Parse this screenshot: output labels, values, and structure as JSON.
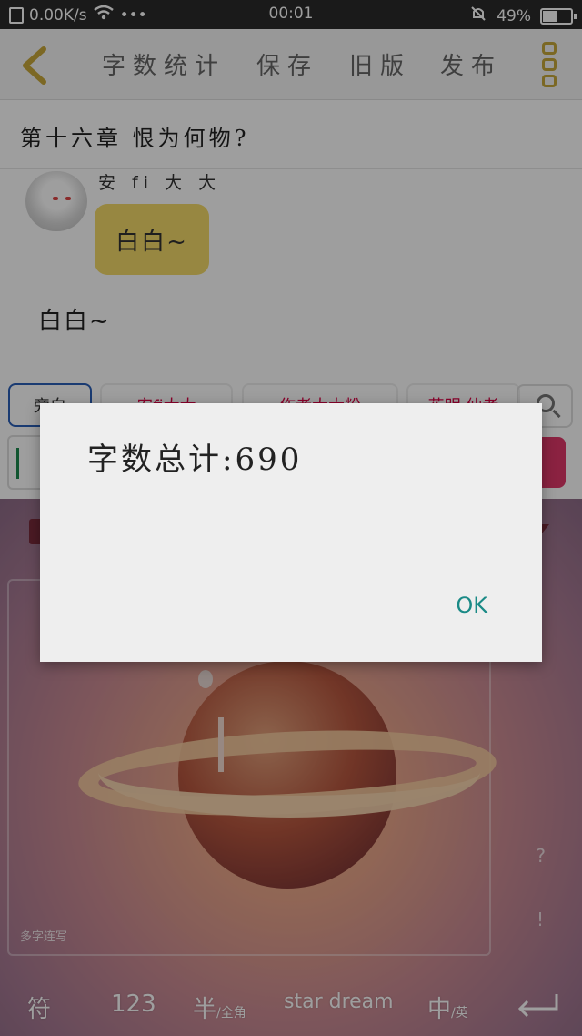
{
  "status_bar": {
    "speed": "0.00K/s",
    "more": "•••",
    "time": "00:01",
    "battery": "49%",
    "battery_level": 0.49
  },
  "toolbar": {
    "word_count": "字数统计",
    "save": "保存",
    "old_version": "旧版",
    "publish": "发布"
  },
  "chapter": {
    "title": "第十六章 恨为何物?"
  },
  "chat": {
    "speaker": "安 fi 大 大",
    "bubble": "白白~",
    "narration": "白白~"
  },
  "chips": [
    {
      "label": "旁白"
    },
    {
      "label": "安fi大大"
    },
    {
      "label": "作者大大粉"
    },
    {
      "label": "花明 仙者"
    }
  ],
  "keyboard": {
    "hint": "多字连写",
    "symbols": "符",
    "numbers": "123",
    "half": "半",
    "full": "/全角",
    "theme": "star dream",
    "lang_zh": "中",
    "lang_en": "/英",
    "q": "?",
    "ex": "!"
  },
  "dialog": {
    "message": "字数总计:690",
    "ok": "OK"
  }
}
